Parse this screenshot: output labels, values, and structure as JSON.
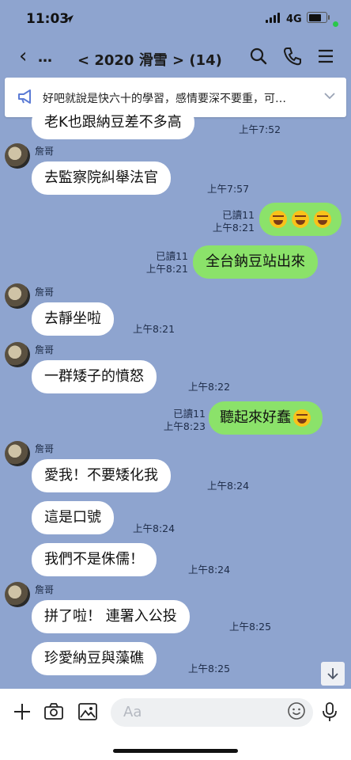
{
  "status_bar": {
    "time": "11:03",
    "network": "4G"
  },
  "header": {
    "back_label": "…",
    "title": "< 2020 滑雪 > (14)"
  },
  "announcement": {
    "text": "好吧就說是快六十的學習，感情要深不要重，可…"
  },
  "messages": [
    {
      "side": "left",
      "text": "老K也跟納豆差不多高",
      "time": "上午7:52"
    },
    {
      "side": "left",
      "sender": "詹哥",
      "text": "去監察院糾舉法官",
      "time": "上午7:57"
    },
    {
      "side": "right",
      "read": "已讀11",
      "time": "上午8:21",
      "emoji": [
        "rofl-emoji",
        "rofl-emoji",
        "rofl-emoji"
      ]
    },
    {
      "side": "right",
      "read": "已讀11",
      "time": "上午8:21",
      "text": "全台鈉豆站出來"
    },
    {
      "side": "left",
      "sender": "詹哥",
      "text": "去靜坐啦",
      "time": "上午8:21"
    },
    {
      "side": "left",
      "sender": "詹哥",
      "text": "一群矮子的憤怒",
      "time": "上午8:22"
    },
    {
      "side": "right",
      "read": "已讀11",
      "time": "上午8:23",
      "text": "聽起來好蠢"
    },
    {
      "side": "left",
      "sender": "詹哥",
      "text": "愛我！不要矮化我",
      "time": "上午8:24"
    },
    {
      "side": "left",
      "text": "這是口號",
      "time": "上午8:24"
    },
    {
      "side": "left",
      "text": "我們不是侏儒！",
      "time": "上午8:24"
    },
    {
      "side": "left",
      "sender": "詹哥",
      "text": "拼了啦！ 連署入公投",
      "time": "上午8:25"
    },
    {
      "side": "left",
      "text": "珍愛納豆與藻礁",
      "time": "上午8:25"
    }
  ],
  "input": {
    "placeholder": "Aa"
  },
  "colors": {
    "chat_bg": "#8ea4cf",
    "my_bubble": "#8be26a",
    "their_bubble": "#ffffff"
  }
}
